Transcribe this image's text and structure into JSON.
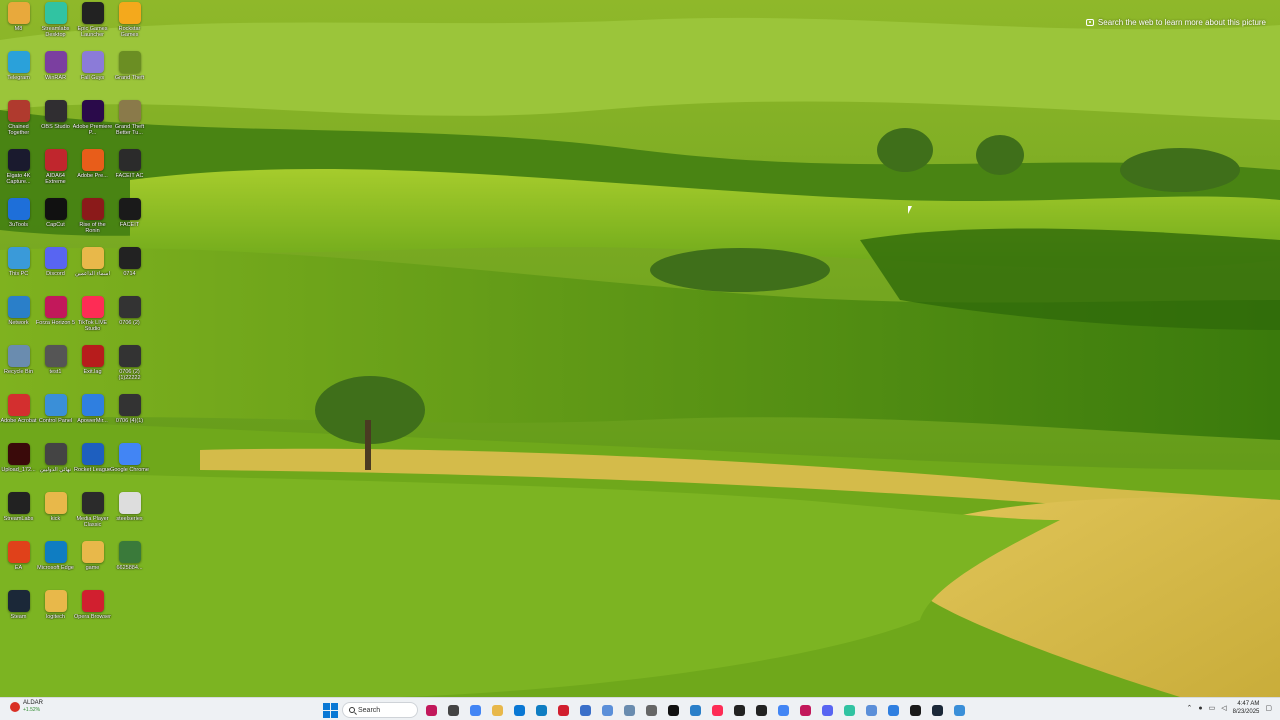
{
  "wallpaper": {
    "spotlight_text": "Search the web to learn more about this picture",
    "colors": {
      "sky_hills": "#9cc22a",
      "dark_green": "#2f6a0a",
      "wheat": "#d9bf4a"
    }
  },
  "desktop_icons": [
    {
      "label": "M8",
      "icon": "folder-icon",
      "color": "#e8a93c"
    },
    {
      "label": "Streamlabs Desktop",
      "icon": "streamlabs-icon",
      "color": "#31c3a2"
    },
    {
      "label": "Epic Games Launcher",
      "icon": "epic-games-icon",
      "color": "#222222"
    },
    {
      "label": "Rockstar Games",
      "icon": "rockstar-icon",
      "color": "#f4a91c"
    },
    {
      "label": "Telegram",
      "icon": "telegram-icon",
      "color": "#2aa1da"
    },
    {
      "label": "WinRAR",
      "icon": "winrar-icon",
      "color": "#7b3fa0"
    },
    {
      "label": "Fall Guys",
      "icon": "fall-guys-icon",
      "color": "#8b7bd8"
    },
    {
      "label": "Grand Theft",
      "icon": "gta-icon",
      "color": "#6b8e23"
    },
    {
      "label": "Chained Together",
      "icon": "chained-icon",
      "color": "#b03a2e"
    },
    {
      "label": "OBS Studio",
      "icon": "obs-icon",
      "color": "#302e31"
    },
    {
      "label": "Adobe Premiere P...",
      "icon": "premiere-icon",
      "color": "#2a0a4a"
    },
    {
      "label": "Grand Theft Better Tu...",
      "icon": "gta-better-icon",
      "color": "#8a7a4a"
    },
    {
      "label": "Elgato 4K Capture...",
      "icon": "elgato-icon",
      "color": "#1a1a2e"
    },
    {
      "label": "AIDA64 Extreme",
      "icon": "aida64-icon",
      "color": "#c0262d"
    },
    {
      "label": "Adobe Pre...",
      "icon": "adobe-pre-icon",
      "color": "#e85d1a"
    },
    {
      "label": "FACEIT AC",
      "icon": "faceit-ac-icon",
      "color": "#2b2b2b"
    },
    {
      "label": "3uTools",
      "icon": "3utools-icon",
      "color": "#1e6fd9"
    },
    {
      "label": "CapCut",
      "icon": "capcut-icon",
      "color": "#111111"
    },
    {
      "label": "Rise of the Ronin",
      "icon": "ronin-icon",
      "color": "#8b1a1a"
    },
    {
      "label": "FACEIT",
      "icon": "faceit-icon",
      "color": "#1a1a1a"
    },
    {
      "label": "This PC",
      "icon": "this-pc-icon",
      "color": "#3a9ad9"
    },
    {
      "label": "Discord",
      "icon": "discord-icon",
      "color": "#5865f2"
    },
    {
      "label": "اسماء الداعمين",
      "icon": "folder-icon",
      "color": "#e8b84a"
    },
    {
      "label": "0714",
      "icon": "video-file-icon",
      "color": "#222222"
    },
    {
      "label": "Network",
      "icon": "network-icon",
      "color": "#2a7fc9"
    },
    {
      "label": "Forza Horizon 5",
      "icon": "forza-icon",
      "color": "#c2185b"
    },
    {
      "label": "TikTok LIVE Studio",
      "icon": "tiktok-icon",
      "color": "#fe2c55"
    },
    {
      "label": "0706 (2)",
      "icon": "video-file-icon",
      "color": "#333333"
    },
    {
      "label": "Recycle Bin",
      "icon": "recycle-bin-icon",
      "color": "#6a8caf"
    },
    {
      "label": "test1",
      "icon": "file-icon",
      "color": "#555555"
    },
    {
      "label": "Exit.lag",
      "icon": "exitlag-icon",
      "color": "#b71c1c"
    },
    {
      "label": "0706 (2)(1)22222",
      "icon": "video-file-icon",
      "color": "#333333"
    },
    {
      "label": "Adobe Acrobat",
      "icon": "acrobat-icon",
      "color": "#d32f2f"
    },
    {
      "label": "Control Panel",
      "icon": "control-panel-icon",
      "color": "#3a8fd8"
    },
    {
      "label": "ApowerMir...",
      "icon": "apowermirror-icon",
      "color": "#2f7fe0"
    },
    {
      "label": "0706 (4)(1)",
      "icon": "video-file-icon",
      "color": "#333333"
    },
    {
      "label": "Upload_172...",
      "icon": "video-file-icon",
      "color": "#3a0a0a"
    },
    {
      "label": "نهائي الدوليين",
      "icon": "image-file-icon",
      "color": "#444444"
    },
    {
      "label": "Rocket League",
      "icon": "rocket-league-icon",
      "color": "#1e5fbf"
    },
    {
      "label": "Google Chrome",
      "icon": "chrome-icon",
      "color": "#4285f4"
    },
    {
      "label": "StreamLabs",
      "icon": "streamlabs-icon",
      "color": "#222222"
    },
    {
      "label": "kick",
      "icon": "folder-icon",
      "color": "#e8b84a"
    },
    {
      "label": "Media Player Classic",
      "icon": "mpc-icon",
      "color": "#2b2b2b"
    },
    {
      "label": "steelseries",
      "icon": "file-icon",
      "color": "#dddddd"
    },
    {
      "label": "EA",
      "icon": "ea-icon",
      "color": "#e0411a"
    },
    {
      "label": "Microsoft Edge",
      "icon": "edge-icon",
      "color": "#0f7dc2"
    },
    {
      "label": "game",
      "icon": "folder-icon",
      "color": "#e8b84a"
    },
    {
      "label": "6625884...",
      "icon": "image-file-icon",
      "color": "#3a7a3a"
    },
    {
      "label": "Steam",
      "icon": "steam-icon",
      "color": "#1b2838"
    },
    {
      "label": "logitech",
      "icon": "folder-icon",
      "color": "#e8b84a"
    },
    {
      "label": "Opera Browser",
      "icon": "opera-icon",
      "color": "#d11f2f"
    }
  ],
  "taskbar": {
    "weather": {
      "title": "ALDAR",
      "subtitle": "+1.52%"
    },
    "search_placeholder": "Search",
    "apps": [
      {
        "icon": "copilot-icon",
        "color": "#c2185b"
      },
      {
        "icon": "task-view-icon",
        "color": "#444444"
      },
      {
        "icon": "chrome-taskbar-icon",
        "color": "#4285f4"
      },
      {
        "icon": "file-explorer-icon",
        "color": "#e8b84a"
      },
      {
        "icon": "mail-icon",
        "color": "#0a78d4"
      },
      {
        "icon": "edge-taskbar-icon",
        "color": "#0f7dc2"
      },
      {
        "icon": "opera-taskbar-icon",
        "color": "#d11f2f"
      },
      {
        "icon": "store-icon",
        "color": "#3a6fc9"
      },
      {
        "icon": "notepad-icon",
        "color": "#5b8fd9"
      },
      {
        "icon": "photos-icon",
        "color": "#6a8caf"
      },
      {
        "icon": "settings-icon",
        "color": "#666666"
      },
      {
        "icon": "capcut-taskbar-icon",
        "color": "#111111"
      },
      {
        "icon": "app-icon",
        "color": "#2a7fc9"
      },
      {
        "icon": "tiktok-taskbar-icon",
        "color": "#fe2c55"
      },
      {
        "icon": "epic-taskbar-icon",
        "color": "#222222"
      },
      {
        "icon": "github-icon",
        "color": "#222222"
      },
      {
        "icon": "chrome-2-icon",
        "color": "#4285f4"
      },
      {
        "icon": "media-icon",
        "color": "#c2185b"
      },
      {
        "icon": "discord-taskbar-icon",
        "color": "#5865f2"
      },
      {
        "icon": "streamlabs-taskbar-icon",
        "color": "#31c3a2"
      },
      {
        "icon": "files-icon",
        "color": "#5b8fd9"
      },
      {
        "icon": "apowermirror-taskbar-icon",
        "color": "#2f7fe0"
      },
      {
        "icon": "faceit-taskbar-icon",
        "color": "#1a1a1a"
      },
      {
        "icon": "steam-taskbar-icon",
        "color": "#1b2838"
      },
      {
        "icon": "app-2-icon",
        "color": "#3a8fd8"
      }
    ],
    "tray": {
      "time": "4:47 AM",
      "date": "8/23/2025"
    }
  }
}
